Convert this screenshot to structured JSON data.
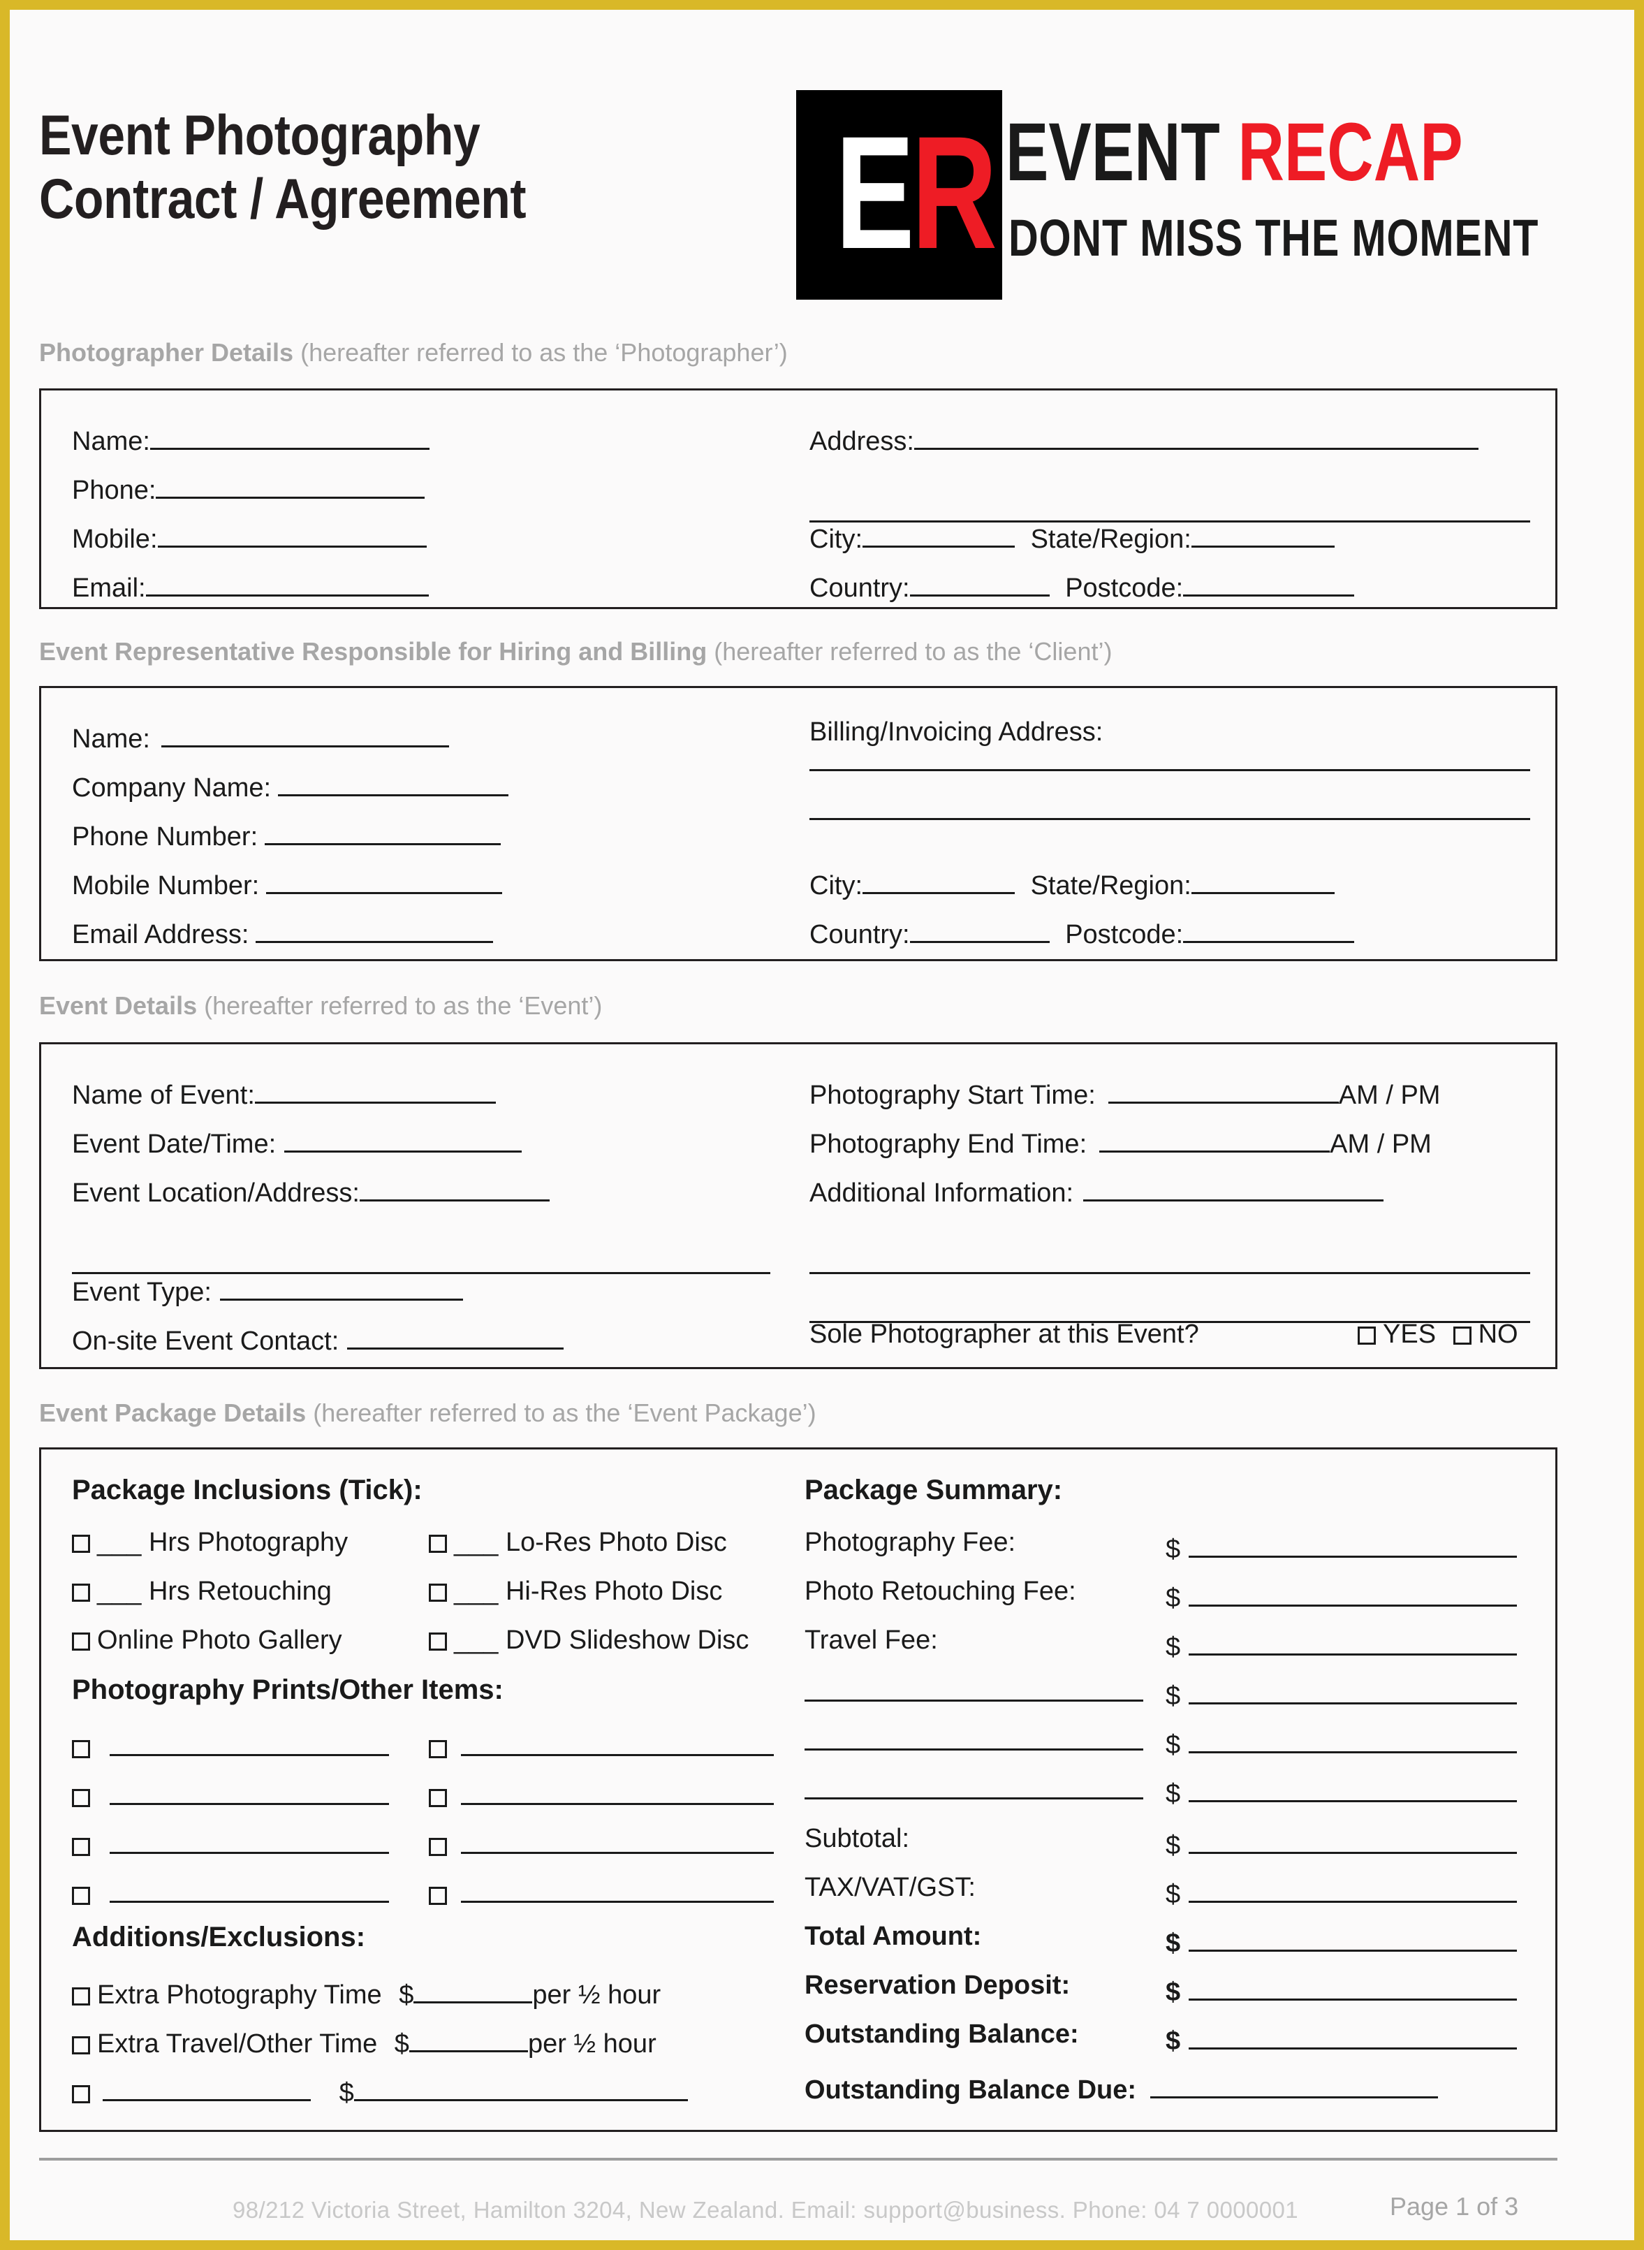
{
  "document": {
    "title_line1": "Event Photography",
    "title_line2": "Contract / Agreement"
  },
  "logo": {
    "mark_e": "E",
    "mark_r": "R",
    "word_black": "EVENT",
    "word_red": "RECAP",
    "tagline": "DONT MISS THE MOMENT",
    "color_red": "#EE1C25",
    "color_black": "#000000"
  },
  "sections": {
    "photographer": {
      "heading_bold": "Photographer Details",
      "heading_note": "(hereafter referred to as the ‘Photographer’)",
      "left": [
        "Name:",
        "Phone:",
        "Mobile:",
        "Email:"
      ],
      "right": {
        "address": "Address:",
        "city": "City:",
        "state": "State/Region:",
        "country": "Country:",
        "postcode": "Postcode:"
      }
    },
    "client": {
      "heading_bold": "Event Representative Responsible for Hiring and Billing",
      "heading_note": "(hereafter referred to as the ‘Client’)",
      "left": [
        "Name:",
        "Company Name:",
        "Phone Number:",
        "Mobile Number:",
        "Email Address:"
      ],
      "right": {
        "billing_address": "Billing/Invoicing Address:",
        "city": "City:",
        "state": "State/Region:",
        "country": "Country:",
        "postcode": "Postcode:"
      }
    },
    "event": {
      "heading_bold": "Event Details",
      "heading_note": "(hereafter referred to as the ‘Event’)",
      "left": [
        "Name of Event:",
        "Event Date/Time:",
        "Event Location/Address:",
        "Event Type:",
        "On-site Event Contact:"
      ],
      "right": {
        "start_time": "Photography Start Time:",
        "end_time": "Photography End Time:",
        "ampm": "AM / PM",
        "additional_info": "Additional Information:",
        "sole_question": "Sole Photographer at this Event?",
        "yes": "YES",
        "no": "NO"
      }
    },
    "package": {
      "heading_bold": "Event Package Details",
      "heading_note": "(hereafter referred to as the ‘Event Package’)",
      "inclusions_title": "Package Inclusions (Tick):",
      "inclusions_left": [
        "___ Hrs Photography",
        "___ Hrs Retouching",
        "Online Photo Gallery"
      ],
      "inclusions_right": [
        "___ Lo-Res Photo Disc",
        "___ Hi-Res Photo Disc",
        "___ DVD Slideshow Disc"
      ],
      "prints_title": "Photography Prints/Other Items:",
      "prints_rows": 4,
      "additions_title": "Additions/Exclusions:",
      "additions": [
        {
          "label": "Extra Photography Time",
          "currency": "$",
          "suffix": "per ½ hour"
        },
        {
          "label": "Extra Travel/Other Time",
          "currency": "$",
          "suffix": "per ½ hour"
        },
        {
          "label": "",
          "currency": "$",
          "suffix": ""
        }
      ],
      "summary_title": "Package Summary:",
      "summary_rows": [
        {
          "label": "Photography Fee:",
          "currency": "$",
          "bold": false,
          "blank_label": false
        },
        {
          "label": "Photo Retouching Fee:",
          "currency": "$",
          "bold": false,
          "blank_label": false
        },
        {
          "label": "Travel Fee:",
          "currency": "$",
          "bold": false,
          "blank_label": false
        },
        {
          "label": "",
          "currency": "$",
          "bold": false,
          "blank_label": true
        },
        {
          "label": "",
          "currency": "$",
          "bold": false,
          "blank_label": true
        },
        {
          "label": "",
          "currency": "$",
          "bold": false,
          "blank_label": true
        },
        {
          "label": "Subtotal:",
          "currency": "$",
          "bold": false,
          "blank_label": false
        },
        {
          "label": "TAX/VAT/GST:",
          "currency": "$",
          "bold": false,
          "blank_label": false
        },
        {
          "label": "Total Amount:",
          "currency": "$",
          "bold": true,
          "blank_label": false
        },
        {
          "label": "Reservation Deposit:",
          "currency": "$",
          "bold": true,
          "blank_label": false
        },
        {
          "label": "Outstanding Balance:",
          "currency": "$",
          "bold": true,
          "blank_label": false
        }
      ],
      "balance_due_label": "Outstanding Balance Due:"
    }
  },
  "footer": {
    "contact": "98/212 Victoria Street, Hamilton 3204, New Zealand. Email: support@business.        Phone: 04 7 0000001",
    "page": "Page 1 of 3"
  }
}
